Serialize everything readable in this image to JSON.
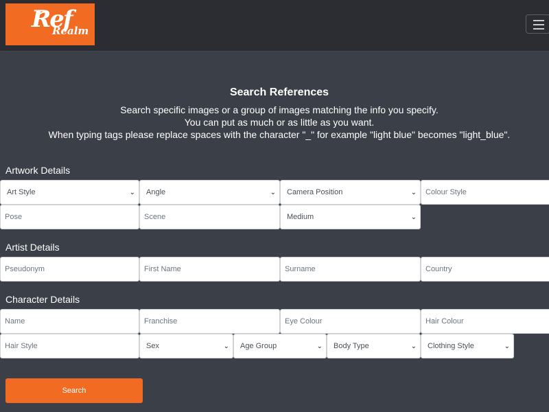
{
  "logo": {
    "big": "Ref",
    "small": "Realm"
  },
  "header": {
    "title": "Search References",
    "desc_lines": [
      "Search specific images or a group of images matching the info you specify.",
      "You can put as much or as little as you want.",
      "When typing tags please replace spaces with the character \"_\" for example \"light blue\" becomes \"light_blue\"."
    ]
  },
  "artwork": {
    "label": "Artwork Details",
    "art_style": "Art Style",
    "angle": "Angle",
    "camera_position": "Camera Position",
    "colour_style": "Colour Style",
    "pose": "Pose",
    "scene": "Scene",
    "medium": "Medium"
  },
  "artist": {
    "label": "Artist Details",
    "pseudonym": "Pseudonym",
    "first_name": "First Name",
    "surname": "Surname",
    "country": "Country"
  },
  "character": {
    "label": "Character Details",
    "name": "Name",
    "franchise": "Franchise",
    "eye_colour": "Eye Colour",
    "hair_colour": "Hair Colour",
    "hair_style": "Hair Style",
    "sex": "Sex",
    "age_group": "Age Group",
    "body_type": "Body Type",
    "clothing_style": "Clothing Style"
  },
  "search_button": "Search",
  "colors": {
    "accent": "#f26b22",
    "navbar": "#2b2d32",
    "background": "#3b3f47"
  },
  "icons": {
    "menu": "hamburger-menu-icon",
    "dropdown": "chevron-down-icon"
  }
}
